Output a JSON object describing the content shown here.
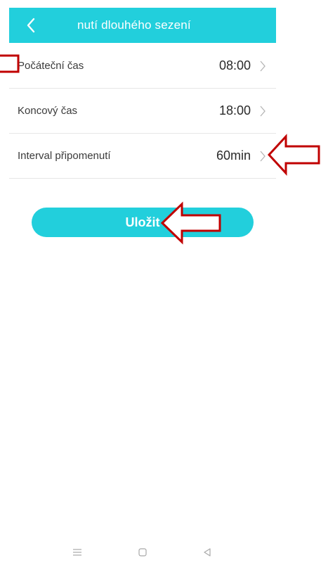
{
  "header": {
    "title": "nutí dlouhého sezení",
    "back_icon": "chevron-left-icon",
    "background_color": "#22cfdc"
  },
  "settings": {
    "items": [
      {
        "label": "Počáteční čas",
        "value": "08:00"
      },
      {
        "label": "Koncový čas",
        "value": "18:00"
      },
      {
        "label": "Interval připomenutí",
        "value": "60min"
      }
    ]
  },
  "save_button": {
    "label": "Uložit"
  },
  "annotations": {
    "color": "#c00000"
  },
  "nav_bar": {
    "icons": [
      "menu-icon",
      "home-icon",
      "back-triangle-icon"
    ]
  }
}
